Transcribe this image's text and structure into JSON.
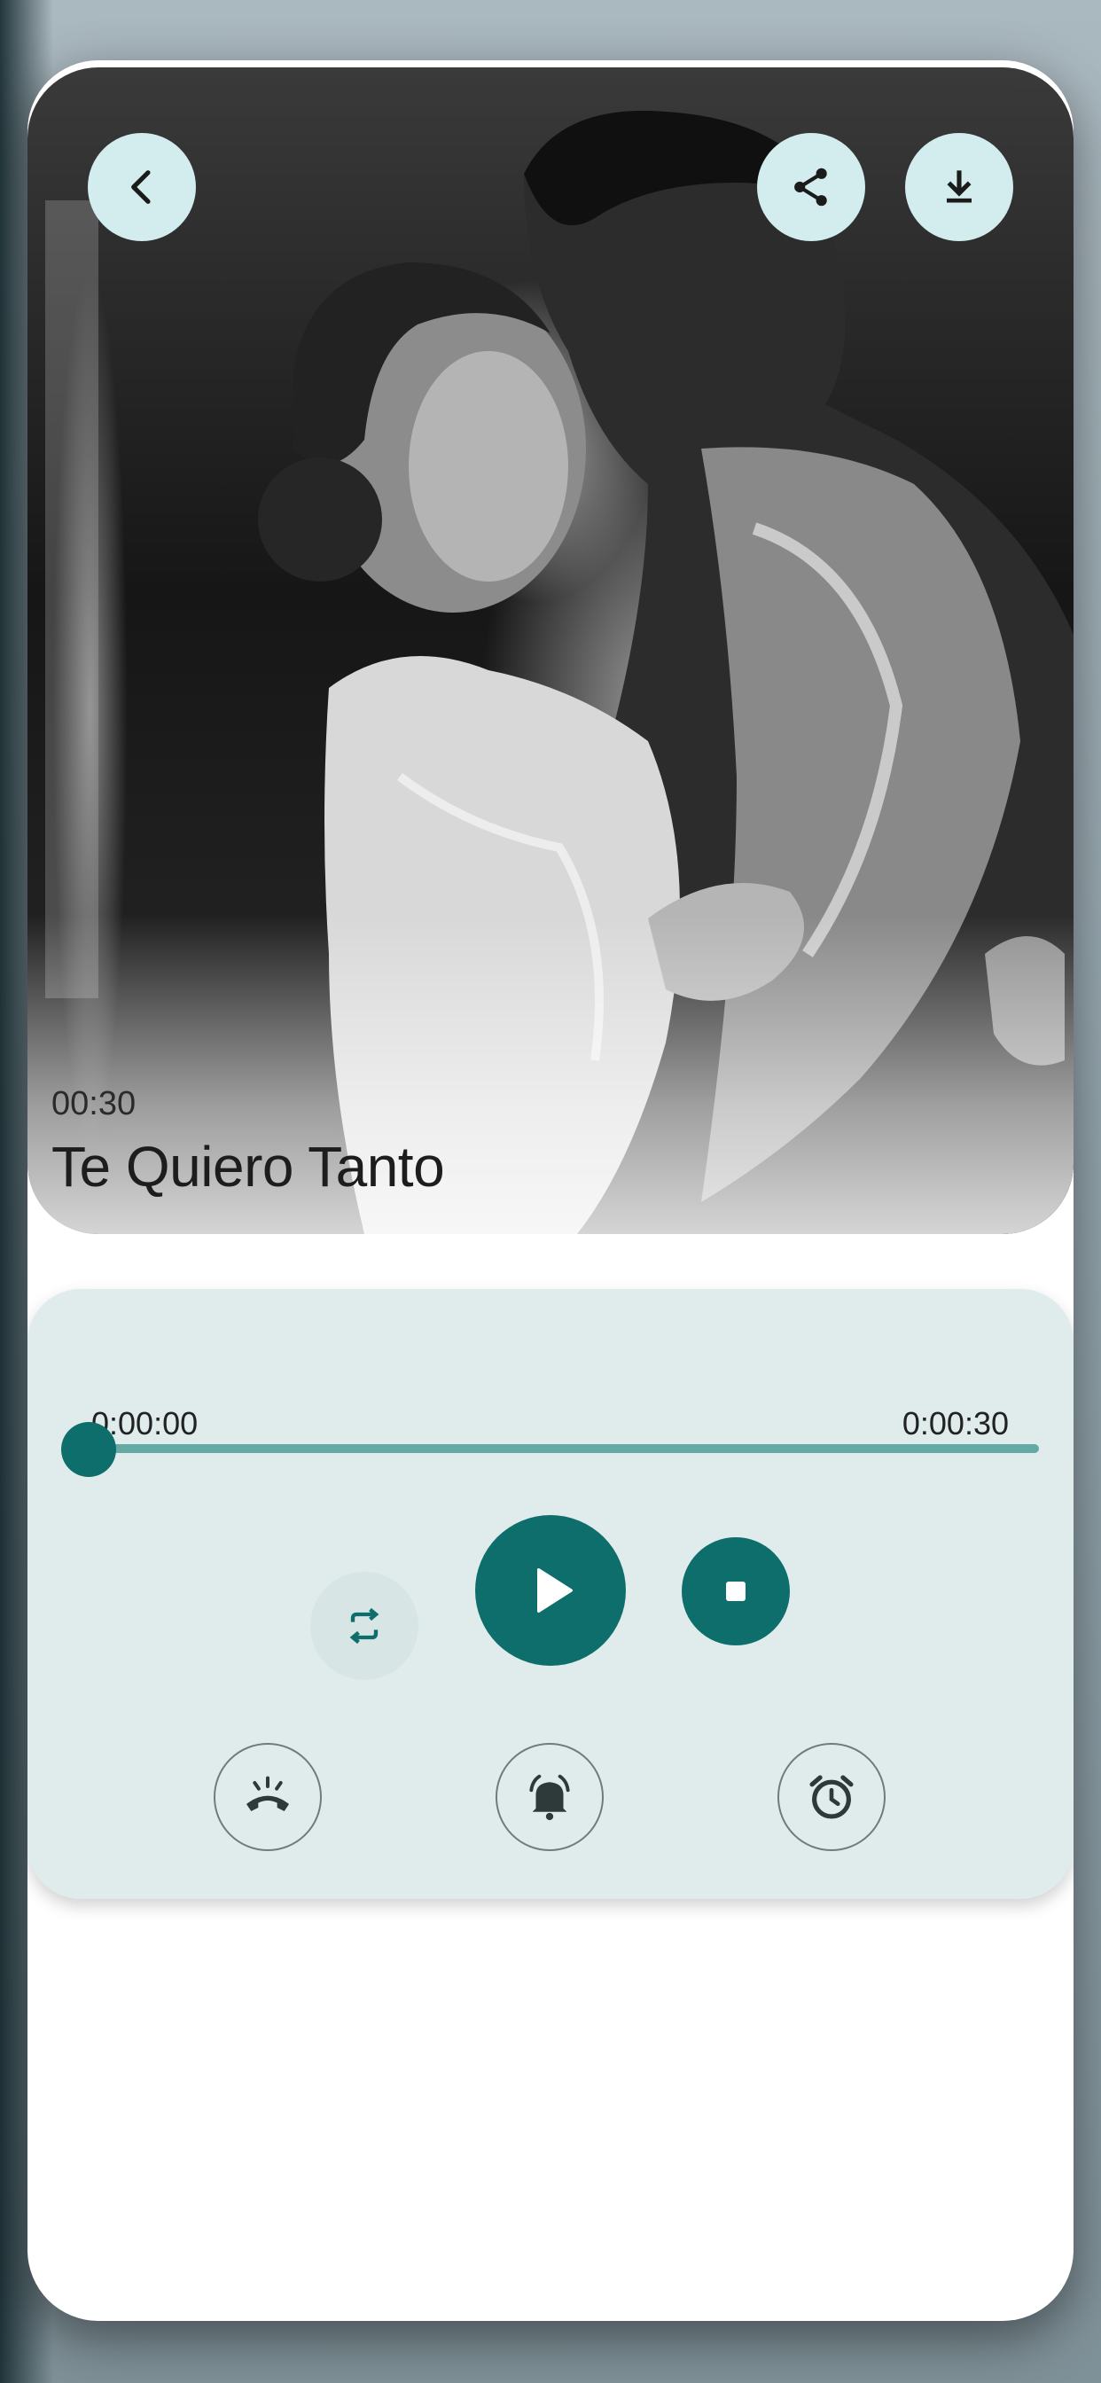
{
  "colors": {
    "accent": "#0e6e6c",
    "track": "#63a9a4",
    "player_bg": "#e0ecec",
    "top_button_bg": "#d3ecee"
  },
  "header": {
    "icons": [
      "back-arrow-icon",
      "share-icon",
      "download-icon"
    ]
  },
  "track_info": {
    "duration": "00:30",
    "title": "Te Quiero Tanto"
  },
  "player": {
    "elapsed": "0:00:00",
    "total": "0:00:30",
    "progress": 0,
    "controls": [
      "repeat-icon",
      "play-icon",
      "stop-icon"
    ],
    "actions": [
      "ringtone-call-icon",
      "notification-bell-icon",
      "alarm-clock-icon"
    ]
  }
}
